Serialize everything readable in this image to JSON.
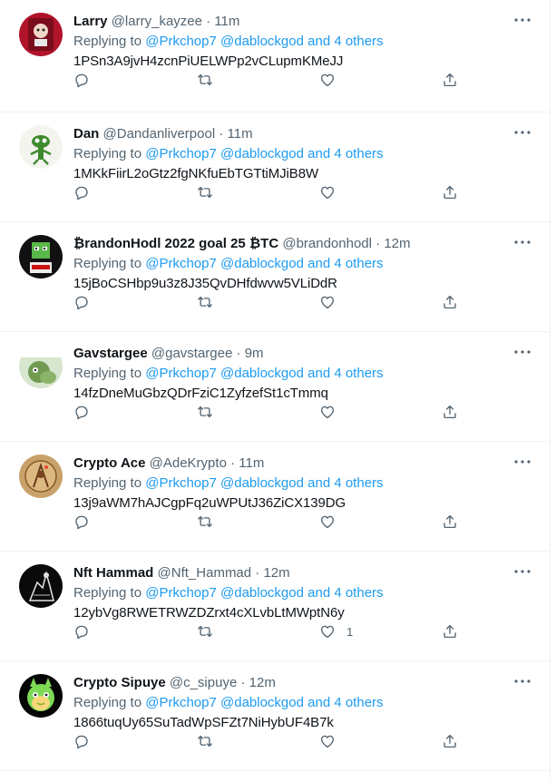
{
  "replying_label": "Replying to",
  "tweets": [
    {
      "name": "Larry",
      "handle": "@larry_kayzee",
      "time": "11m",
      "mention1": "@Prkchop7",
      "mention2": "@dablockgod",
      "others": "and 4 others",
      "text": "1PSn3A9jvH4zcnPiUELWPp2vCLupmKMeJJ",
      "likes": ""
    },
    {
      "name": "Dan",
      "handle": "@Dandanliverpool",
      "time": "11m",
      "mention1": "@Prkchop7",
      "mention2": "@dablockgod",
      "others": "and 4 others",
      "text": "1MKkFiirL2oGtz2fgNKfuEbTGTtiMJiB8W",
      "likes": ""
    },
    {
      "name": "₿randonHodl 2022 goal 25 ₿TC",
      "handle": "@brandonhodl",
      "time": "12m",
      "mention1": "@Prkchop7",
      "mention2": "@dablockgod",
      "others": "and 4 others",
      "text": "15jBoCSHbp9u3z8J35QvDHfdwvw5VLiDdR",
      "likes": ""
    },
    {
      "name": "Gavstargee",
      "handle": "@gavstargee",
      "time": "9m",
      "mention1": "@Prkchop7",
      "mention2": "@dablockgod",
      "others": "and 4 others",
      "text": "14fzDneMuGbzQDrFziC1ZyfzefSt1cTmmq",
      "likes": ""
    },
    {
      "name": "Crypto Ace",
      "handle": "@AdeKrypto",
      "time": "11m",
      "mention1": "@Prkchop7",
      "mention2": "@dablockgod",
      "others": "and 4 others",
      "text": "13j9aWM7hAJCgpFq2uWPUtJ36ZiCX139DG",
      "likes": ""
    },
    {
      "name": "Nft Hammad",
      "handle": "@Nft_Hammad",
      "time": "12m",
      "mention1": "@Prkchop7",
      "mention2": "@dablockgod",
      "others": "and 4 others",
      "text": "12ybVg8RWETRWZDZrxt4cXLvbLtMWptN6y",
      "likes": "1"
    },
    {
      "name": "Crypto Sipuye",
      "handle": "@c_sipuye",
      "time": "12m",
      "mention1": "@Prkchop7",
      "mention2": "@dablockgod",
      "others": "and 4 others",
      "text": "1866tuqUy65SuTadWpSFZt7NiHybUF4B7k",
      "likes": ""
    }
  ],
  "icons": {
    "reply": "reply-icon",
    "retweet": "retweet-icon",
    "like": "heart-icon",
    "share": "share-icon",
    "more": "more-icon"
  },
  "colors": {
    "mention": "#1d9bf0",
    "secondary_text": "#536471",
    "primary_text": "#0f1419",
    "divider": "#eff3f4"
  }
}
